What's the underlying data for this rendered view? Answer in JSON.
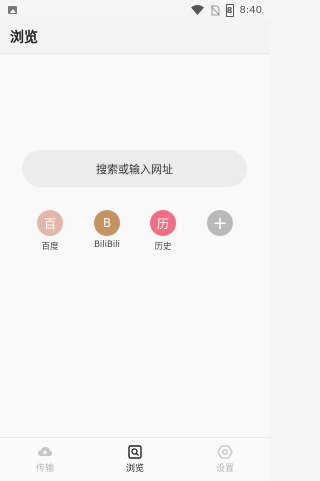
{
  "status_bar": {
    "time": "8:40",
    "battery_level": "8"
  },
  "title_bar": {
    "title": "浏览"
  },
  "search": {
    "placeholder": "搜索或输入网址"
  },
  "shortcuts": [
    {
      "glyph": "百",
      "label": "百度",
      "color": "#e2b6a9"
    },
    {
      "glyph": "B",
      "label": "BiliBili",
      "color": "#c5935f"
    },
    {
      "glyph": "历",
      "label": "历史",
      "color": "#f36c84"
    },
    {
      "glyph": "+",
      "label": "",
      "color": "#b9b9b9"
    }
  ],
  "bottom_nav": [
    {
      "label": "传输",
      "icon": "cloud-icon",
      "active": false
    },
    {
      "label": "浏览",
      "icon": "browse-search-icon",
      "active": true
    },
    {
      "label": "设置",
      "icon": "settings-gear-icon",
      "active": false
    }
  ]
}
